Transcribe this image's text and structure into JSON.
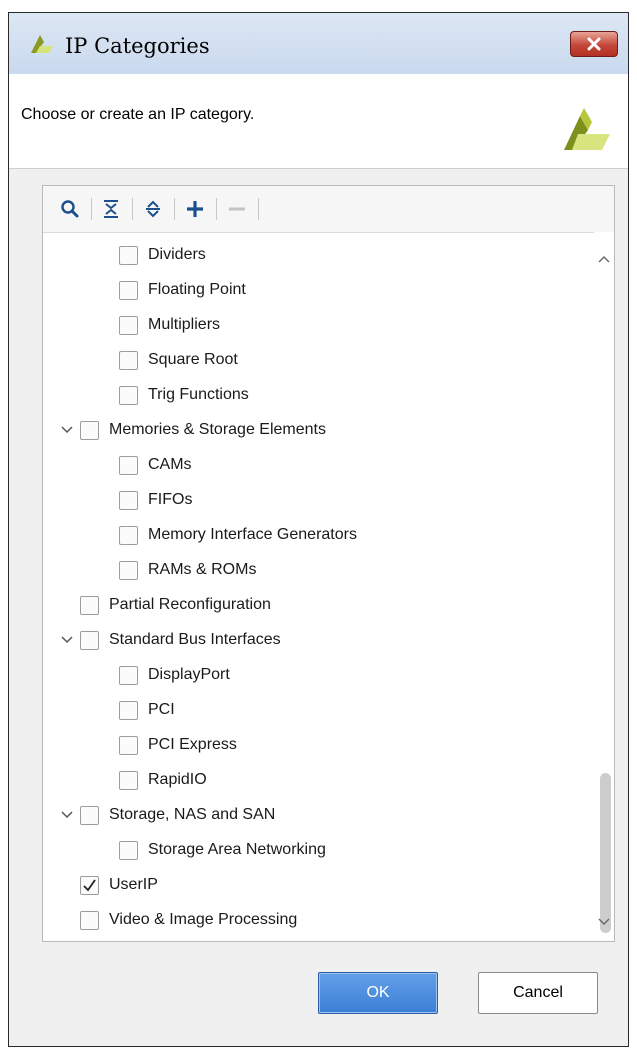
{
  "window": {
    "title": "IP Categories"
  },
  "header": {
    "description": "Choose or create an IP category."
  },
  "toolbar": {
    "search_icon": "search-icon",
    "collapse_icon": "collapse-all-icon",
    "expand_icon": "expand-all-icon",
    "add_icon": "plus-icon",
    "remove_icon": "minus-icon"
  },
  "tree": {
    "items": [
      {
        "label": "Dividers",
        "checked": false
      },
      {
        "label": "Floating Point",
        "checked": false
      },
      {
        "label": "Multipliers",
        "checked": false
      },
      {
        "label": "Square Root",
        "checked": false
      },
      {
        "label": "Trig Functions",
        "checked": false
      },
      {
        "label": "Memories & Storage Elements",
        "checked": false,
        "expanded": true
      },
      {
        "label": "CAMs",
        "checked": false
      },
      {
        "label": "FIFOs",
        "checked": false
      },
      {
        "label": "Memory Interface Generators",
        "checked": false
      },
      {
        "label": "RAMs & ROMs",
        "checked": false
      },
      {
        "label": "Partial Reconfiguration",
        "checked": false
      },
      {
        "label": "Standard Bus Interfaces",
        "checked": false,
        "expanded": true
      },
      {
        "label": "DisplayPort",
        "checked": false
      },
      {
        "label": "PCI",
        "checked": false
      },
      {
        "label": "PCI Express",
        "checked": false
      },
      {
        "label": "RapidIO",
        "checked": false
      },
      {
        "label": "Storage, NAS and SAN",
        "checked": false,
        "expanded": true
      },
      {
        "label": "Storage Area Networking",
        "checked": false
      },
      {
        "label": "UserIP",
        "checked": true
      },
      {
        "label": "Video & Image Processing",
        "checked": false
      }
    ]
  },
  "buttons": {
    "ok": "OK",
    "cancel": "Cancel"
  },
  "colors": {
    "accent": "#3c7fd6",
    "logo_dark": "#6b7a1e",
    "logo_light": "#d6e27a"
  }
}
